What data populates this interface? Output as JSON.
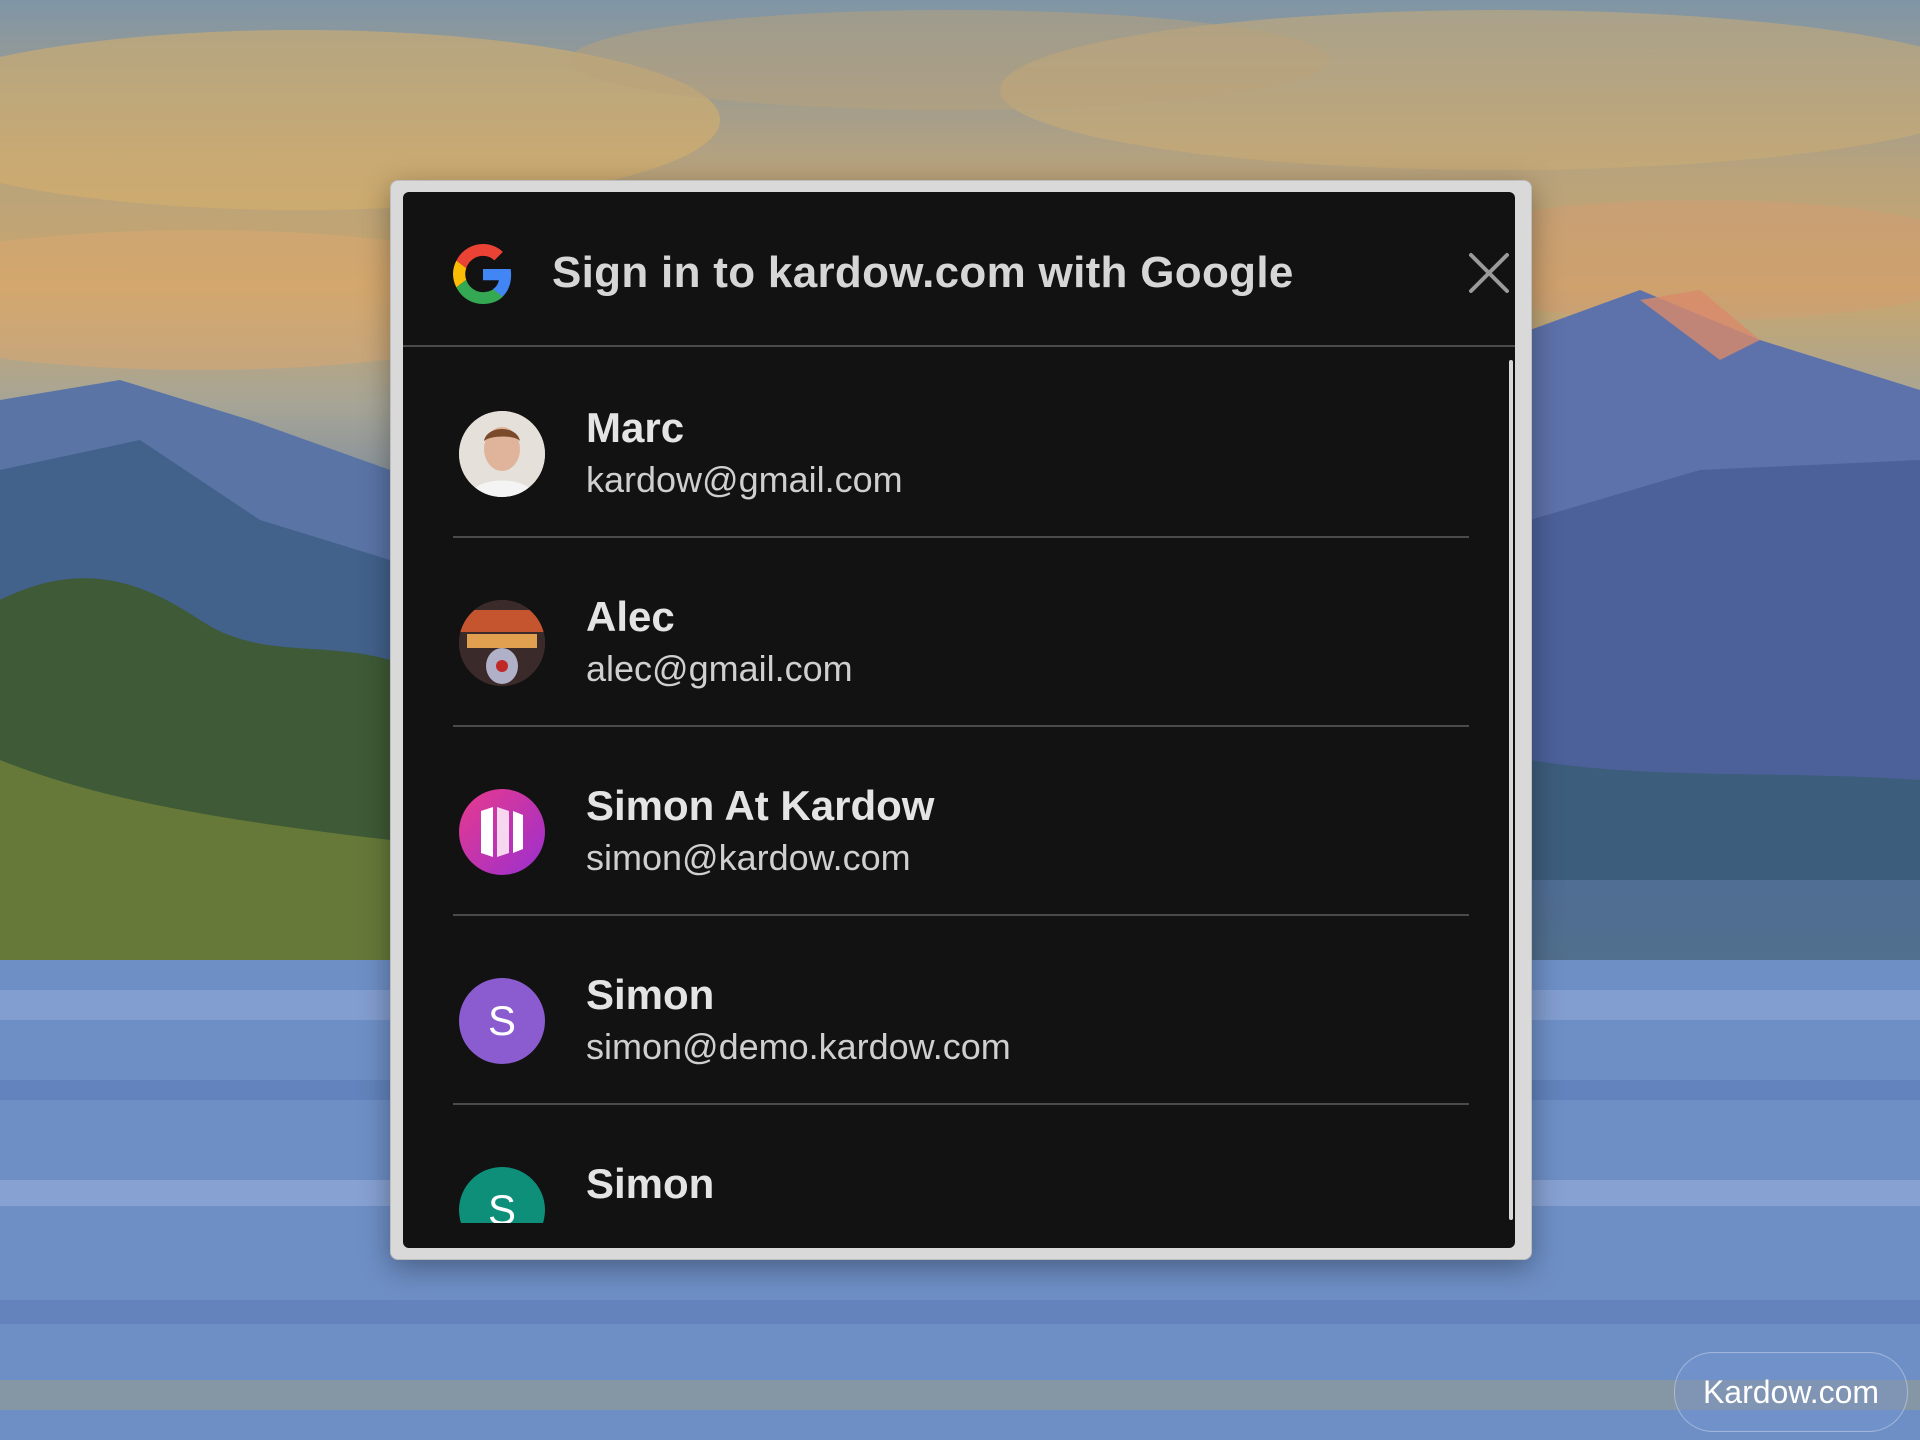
{
  "dialog": {
    "title": "Sign in to kardow.com with Google",
    "close_icon": "close-icon",
    "logo_icon": "google-g-icon"
  },
  "accounts": [
    {
      "name": "Marc",
      "email": "kardow@gmail.com",
      "avatar": "photo-avatar",
      "avatar_color": "#d9c6b8"
    },
    {
      "name": "Alec",
      "email": "alec@gmail.com",
      "avatar": "photo-avatar",
      "avatar_color": "#6a3a2a"
    },
    {
      "name": "Simon At Kardow",
      "email": "simon@kardow.com",
      "avatar": "kardow-logo-avatar",
      "avatar_color": "#c43db0"
    },
    {
      "name": "Simon",
      "email": "simon@demo.kardow.com",
      "avatar": "initial-avatar",
      "avatar_letter": "S",
      "avatar_color": "#8a5ccf"
    },
    {
      "name": "Simon",
      "email": "",
      "avatar": "initial-avatar",
      "avatar_letter": "S",
      "avatar_color": "#0e8f7a"
    }
  ],
  "badge": {
    "label": "Kardow.com"
  }
}
